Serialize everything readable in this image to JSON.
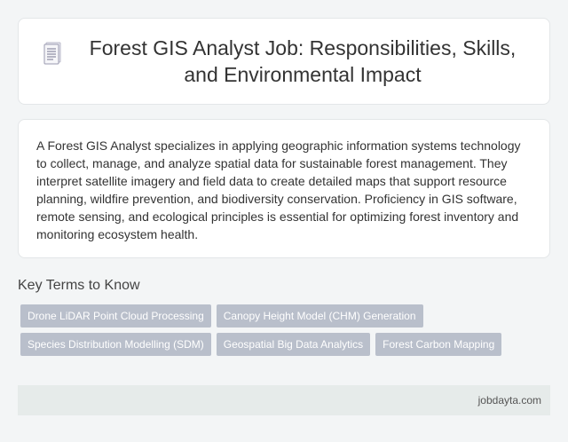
{
  "header": {
    "title": "Forest GIS Analyst Job: Responsibilities, Skills, and Environmental Impact",
    "icon": "document-icon"
  },
  "summary": {
    "text": "A Forest GIS Analyst specializes in applying geographic information systems technology to collect, manage, and analyze spatial data for sustainable forest management. They interpret satellite imagery and field data to create detailed maps that support resource planning, wildfire prevention, and biodiversity conservation. Proficiency in GIS software, remote sensing, and ecological principles is essential for optimizing forest inventory and monitoring ecosystem health."
  },
  "key_terms": {
    "heading": "Key Terms to Know",
    "tags": [
      "Drone LiDAR Point Cloud Processing",
      "Canopy Height Model (CHM) Generation",
      "Species Distribution Modelling (SDM)",
      "Geospatial Big Data Analytics",
      "Forest Carbon Mapping"
    ]
  },
  "footer": {
    "site": "jobdayta.com"
  },
  "colors": {
    "background": "#f3f5f6",
    "card": "#ffffff",
    "tag": "#b9bfcb",
    "footer": "#e6ebea"
  }
}
